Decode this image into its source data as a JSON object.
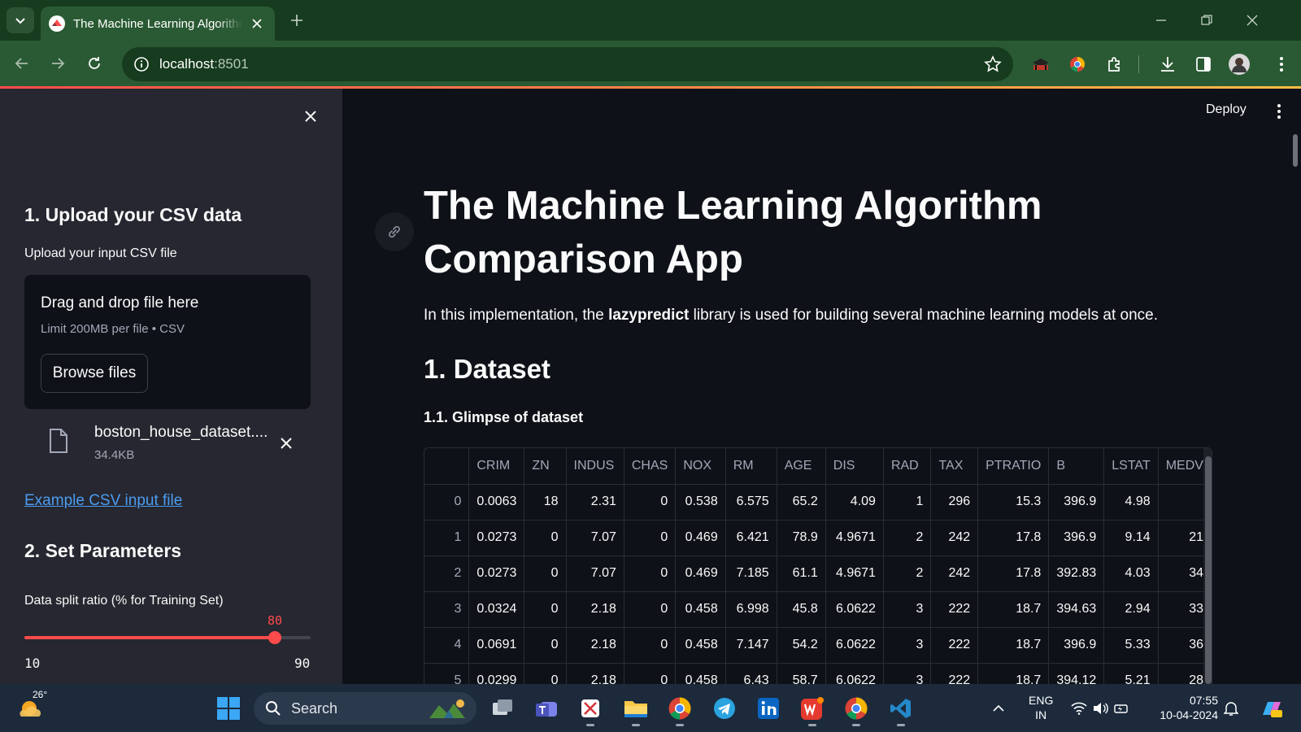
{
  "browser": {
    "tab_title": "The Machine Learning Algorithm Comparison App",
    "url_host": "localhost",
    "url_port": ":8501"
  },
  "sidebar": {
    "section1_title": "1. Upload your CSV data",
    "upload_label": "Upload your input CSV file",
    "dropzone_title": "Drag and drop file here",
    "dropzone_limit": "Limit 200MB per file • CSV",
    "browse_label": "Browse files",
    "file_name": "boston_house_dataset.csv",
    "file_size": "34.4KB",
    "example_link": "Example CSV input file",
    "section2_title": "2. Set Parameters",
    "split_label": "Data split ratio (% for Training Set)",
    "split_value": "80",
    "split_min": "10",
    "split_max": "90",
    "split_fraction": 0.875
  },
  "main": {
    "deploy_label": "Deploy",
    "title": "The Machine Learning Algorithm Comparison App",
    "intro_prefix": "In this implementation, the ",
    "intro_bold": "lazypredict",
    "intro_suffix": " library is used for building several machine learning models at once.",
    "section_title": "1. Dataset",
    "subsection_title": "1.1. Glimpse of dataset"
  },
  "table": {
    "columns": [
      "CRIM",
      "ZN",
      "INDUS",
      "CHAS",
      "NOX",
      "RM",
      "AGE",
      "DIS",
      "RAD",
      "TAX",
      "PTRATIO",
      "B",
      "LSTAT",
      "MEDV"
    ],
    "rows": [
      [
        "0",
        "0.0063",
        "18",
        "2.31",
        "0",
        "0.538",
        "6.575",
        "65.2",
        "4.09",
        "1",
        "296",
        "15.3",
        "396.9",
        "4.98",
        ""
      ],
      [
        "1",
        "0.0273",
        "0",
        "7.07",
        "0",
        "0.469",
        "6.421",
        "78.9",
        "4.9671",
        "2",
        "242",
        "17.8",
        "396.9",
        "9.14",
        "21"
      ],
      [
        "2",
        "0.0273",
        "0",
        "7.07",
        "0",
        "0.469",
        "7.185",
        "61.1",
        "4.9671",
        "2",
        "242",
        "17.8",
        "392.83",
        "4.03",
        "34"
      ],
      [
        "3",
        "0.0324",
        "0",
        "2.18",
        "0",
        "0.458",
        "6.998",
        "45.8",
        "6.0622",
        "3",
        "222",
        "18.7",
        "394.63",
        "2.94",
        "33"
      ],
      [
        "4",
        "0.0691",
        "0",
        "2.18",
        "0",
        "0.458",
        "7.147",
        "54.2",
        "6.0622",
        "3",
        "222",
        "18.7",
        "396.9",
        "5.33",
        "36"
      ],
      [
        "5",
        "0.0299",
        "0",
        "2.18",
        "0",
        "0.458",
        "6.43",
        "58.7",
        "6.0622",
        "3",
        "222",
        "18.7",
        "394.12",
        "5.21",
        "28"
      ]
    ]
  },
  "taskbar": {
    "temperature": "26°",
    "search_placeholder": "Search",
    "lang_line1": "ENG",
    "lang_line2": "IN",
    "time": "07:55",
    "date": "10-04-2024"
  },
  "colors": {
    "accent": "#ff4b4b",
    "link": "#4c9cf0",
    "sidebar_bg": "#262730",
    "main_bg": "#0e1117",
    "browser_frame": "#2a5a33"
  }
}
